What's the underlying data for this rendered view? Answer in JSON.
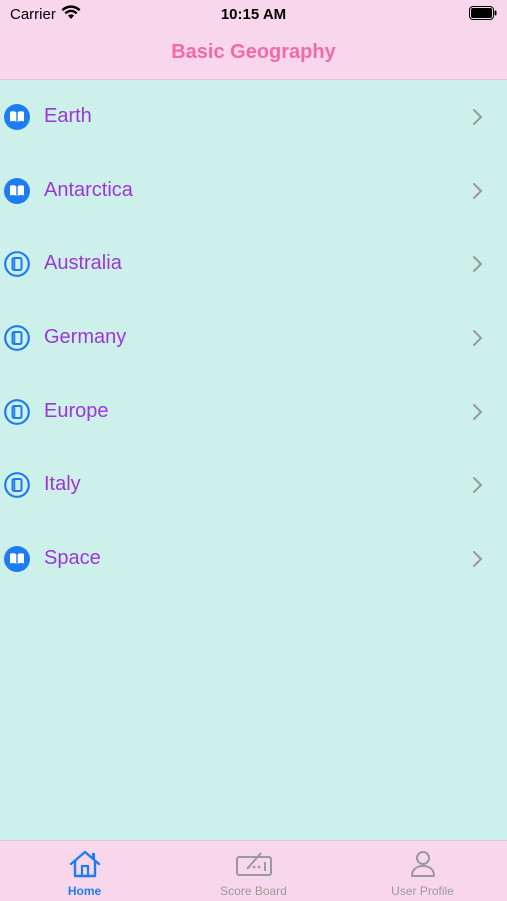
{
  "status": {
    "carrier": "Carrier",
    "time": "10:15 AM"
  },
  "nav": {
    "title": "Basic Geography"
  },
  "colors": {
    "accent": "#1e7cf2",
    "label": "#9b37d6",
    "title": "#f26aa9",
    "background": "#cdf0ea",
    "bar": "#f8d7ec"
  },
  "list": {
    "items": [
      {
        "label": "Earth",
        "icon": "open-book-icon"
      },
      {
        "label": "Antarctica",
        "icon": "open-book-icon"
      },
      {
        "label": "Australia",
        "icon": "closed-book-icon"
      },
      {
        "label": "Germany",
        "icon": "closed-book-icon"
      },
      {
        "label": "Europe",
        "icon": "closed-book-icon"
      },
      {
        "label": "Italy",
        "icon": "closed-book-icon"
      },
      {
        "label": "Space",
        "icon": "open-book-icon"
      }
    ]
  },
  "tabs": [
    {
      "label": "Home",
      "icon": "home-icon",
      "active": true
    },
    {
      "label": "Score Board",
      "icon": "scoreboard-icon",
      "active": false
    },
    {
      "label": "User Profile",
      "icon": "user-icon",
      "active": false
    }
  ]
}
